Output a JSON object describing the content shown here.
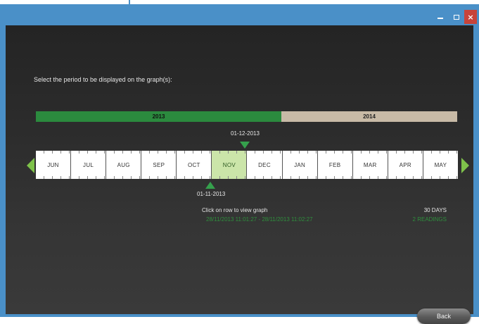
{
  "window": {
    "minimize_label": "",
    "maximize_label": "",
    "close_label": "×"
  },
  "prompt": "Select the period to be displayed on the graph(s):",
  "years": [
    {
      "label": "2013"
    },
    {
      "label": "2014"
    }
  ],
  "selection": {
    "start_date": "01-11-2013",
    "end_date": "01-12-2013"
  },
  "months": [
    {
      "label": "JUN"
    },
    {
      "label": "JUL"
    },
    {
      "label": "AUG"
    },
    {
      "label": "SEP"
    },
    {
      "label": "OCT"
    },
    {
      "label": "NOV"
    },
    {
      "label": "DEC"
    },
    {
      "label": "JAN"
    },
    {
      "label": "FEB"
    },
    {
      "label": "MAR"
    },
    {
      "label": "APR"
    },
    {
      "label": "MAY"
    }
  ],
  "selected_month": "NOV",
  "info": {
    "hint": "Click on row to view graph",
    "range": "28/11/2013 11:01:27 - 28/11/2013 11:02:27",
    "days": "30 DAYS",
    "readings": "2 READINGS"
  },
  "back_label": "Back",
  "colors": {
    "year_2013": "#2b8a3e",
    "year_2014": "#c8baa6",
    "selected_month": "#cbe5a9",
    "accent_green": "#35a04c",
    "nav_arrow": "#7ec24a"
  }
}
